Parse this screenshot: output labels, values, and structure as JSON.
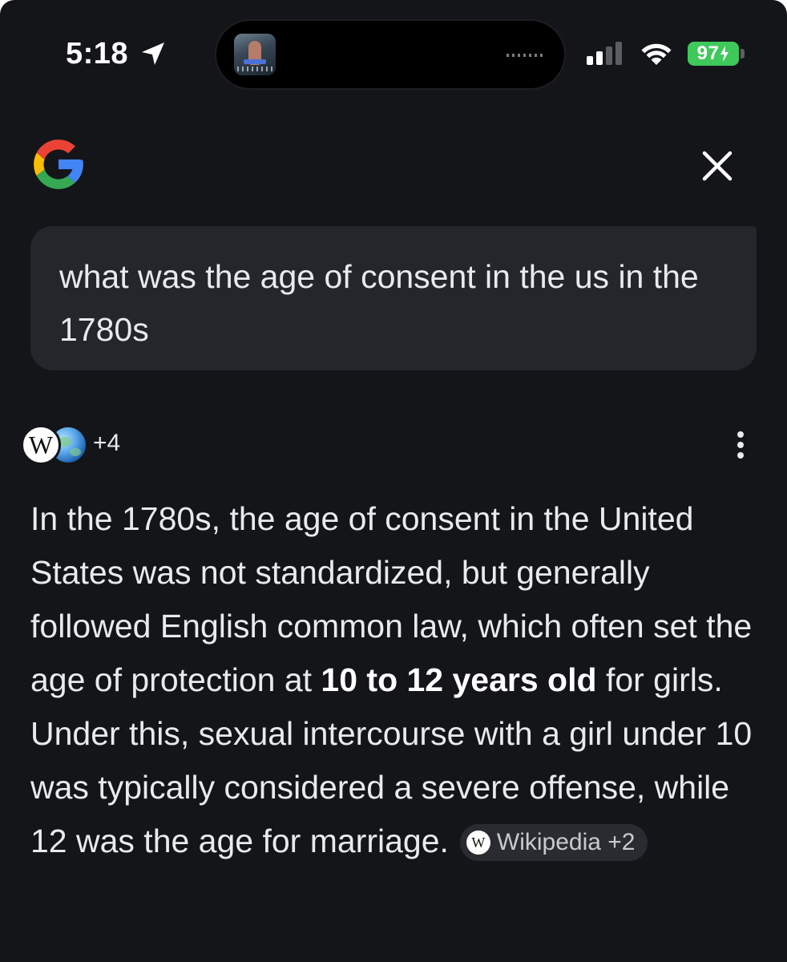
{
  "status_bar": {
    "time": "5:18",
    "battery": "97"
  },
  "search": {
    "query": "what was the age of consent in the us in the 1780s"
  },
  "sources": {
    "wikipedia_glyph": "W",
    "more_count": "+4"
  },
  "answer": {
    "part1": "In the 1780s, the age of consent in the United States was not standardized, but generally followed English common law, which often set the age of protection at ",
    "bold": "10 to 12 years old",
    "part2": " for girls. Under this, sexual intercourse with a girl under 10 was typically considered a severe offense, while 12 was the age for marriage.",
    "citation": "Wikipedia +2"
  },
  "icons": [
    "location-arrow-icon",
    "cellular-signal-icon",
    "wifi-icon",
    "battery-charging-icon",
    "google-logo-icon",
    "close-icon",
    "more-vertical-icon",
    "wikipedia-icon",
    "globe-icon"
  ],
  "colors": {
    "background": "#141519",
    "query_bubble": "#25262b",
    "text": "#e8eaed",
    "battery_green": "#3ec95a",
    "google_blue": "#4285F4",
    "google_red": "#EA4335",
    "google_yellow": "#FBBC05",
    "google_green": "#34A853"
  }
}
